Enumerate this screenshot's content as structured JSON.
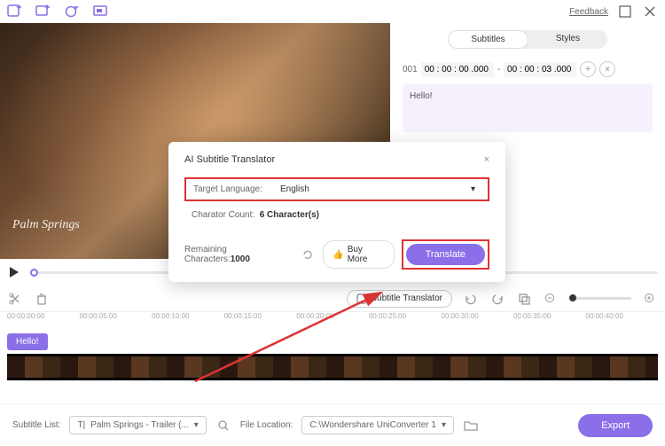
{
  "topbar": {
    "feedback": "Feedback"
  },
  "preview": {
    "watermark": "Palm Springs"
  },
  "sidepanel": {
    "tabs": {
      "subtitles": "Subtitles",
      "styles": "Styles"
    },
    "index": "001",
    "time_start": "00 : 00 : 00 .000",
    "sep": "-",
    "time_end": "00 : 00 : 03 .000",
    "text": "Hello!"
  },
  "toolbar": {
    "subtitle_translator": "Subtitle Translator"
  },
  "timeline": {
    "marks": [
      "00:00:00:00",
      "00:00:05:00",
      "00:00:10:00",
      "00:00:15:00",
      "00:00:20:00",
      "00:00:25:00",
      "00:00:30:00",
      "00:00:35:00",
      "00:00:40:00"
    ]
  },
  "track": {
    "chip": "Hello!"
  },
  "bottombar": {
    "subtitle_list": "Subtitle List:",
    "subtitle_file": "Palm Springs - Trailer (...",
    "file_location": "File Location:",
    "path": "C:\\Wondershare UniConverter 1",
    "export": "Export"
  },
  "modal": {
    "title": "AI Subtitle Translator",
    "target_label": "Target Language:",
    "target_value": "English",
    "char_label": "Charator Count:",
    "char_value": "6 Character(s)",
    "remain_label": "Remaining Characters:",
    "remain_value": "1000",
    "buy_more": "Buy More",
    "translate": "Translate"
  }
}
